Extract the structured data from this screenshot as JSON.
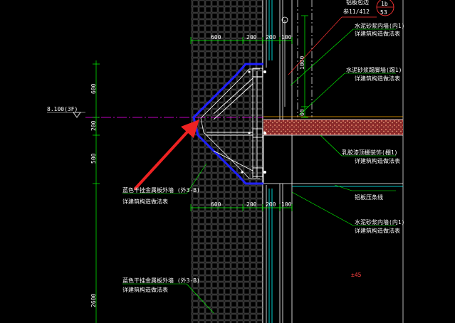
{
  "drawing": {
    "level_mark": "8.100(3F)",
    "detail_ref": {
      "top_label": "1b",
      "bottom_label": "53",
      "above_text": "铝板包边",
      "ref_code": "参11/412"
    },
    "dims_top": [
      "600",
      "200",
      "200",
      "100"
    ],
    "dims_mid": [
      "600",
      "200",
      "200",
      "100"
    ],
    "dims_left": [
      "600",
      "200",
      "500",
      "2600"
    ],
    "dim_right_vertical": "1000",
    "dim_right_small": "00",
    "callouts_right": [
      {
        "line1": "水泥砂浆内墙(内1)",
        "line2": "详建筑构造做法表"
      },
      {
        "line1": "水泥砂浆踢脚墙(踢1)",
        "line2": "详建筑构造做法表"
      },
      {
        "line1": "乳胶漆顶棚装饰(棚1)",
        "line2": "详建筑构造做法表"
      },
      {
        "line1": "铝板压条线",
        "line2": ""
      },
      {
        "line1": "水泥砂浆内墙(内1)",
        "line2": "详建筑构造做法表"
      }
    ],
    "callouts_left": [
      {
        "line1": "蓝色干挂金属板外墙 (外3-B)",
        "line2": "详建筑构造做法表"
      },
      {
        "line1": "蓝色干挂金属板外墙 (外3-B)",
        "line2": "详建筑构造做法表"
      }
    ],
    "small_red_text": "±45",
    "colors": {
      "background": "#000000",
      "brick": "#5a5a5a",
      "panel": "#2020ff",
      "slab": "#ff6060",
      "arrow": "#ee2222",
      "dimension": "#00ff00",
      "magenta_line": "#ff00ff",
      "cyan": "#00ffff"
    }
  }
}
